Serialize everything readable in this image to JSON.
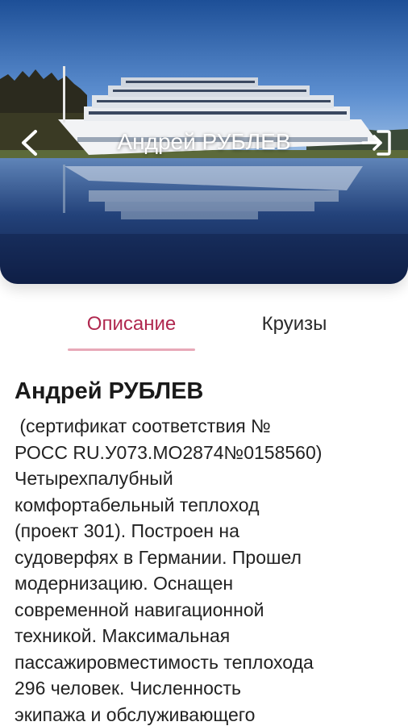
{
  "header": {
    "title": "Андрей РУБЛЕВ",
    "back_icon": "chevron-left-icon",
    "login_icon": "login-icon"
  },
  "tabs": [
    {
      "label": "Описание",
      "active": true
    },
    {
      "label": "Круизы",
      "active": false
    }
  ],
  "colors": {
    "accent": "#b0284f",
    "tab_underline": "#e8a9b8"
  },
  "description": {
    "title": "Андрей РУБЛЕВ",
    "lines": [
      " (сертификат соответствия №",
      "РОСС RU.У073.МО2874№0158560)",
      "Четырехпалубный",
      "комфортабельный теплоход",
      "(проект 301). Построен на",
      "судоверфях в Германии. Прошел",
      "модернизацию. Оснащен",
      "современной навигационной",
      "техникой. Максимальная",
      "пассажировместимость теплохода",
      "296 человек. Численность",
      "экипажа и обслуживающего"
    ]
  }
}
